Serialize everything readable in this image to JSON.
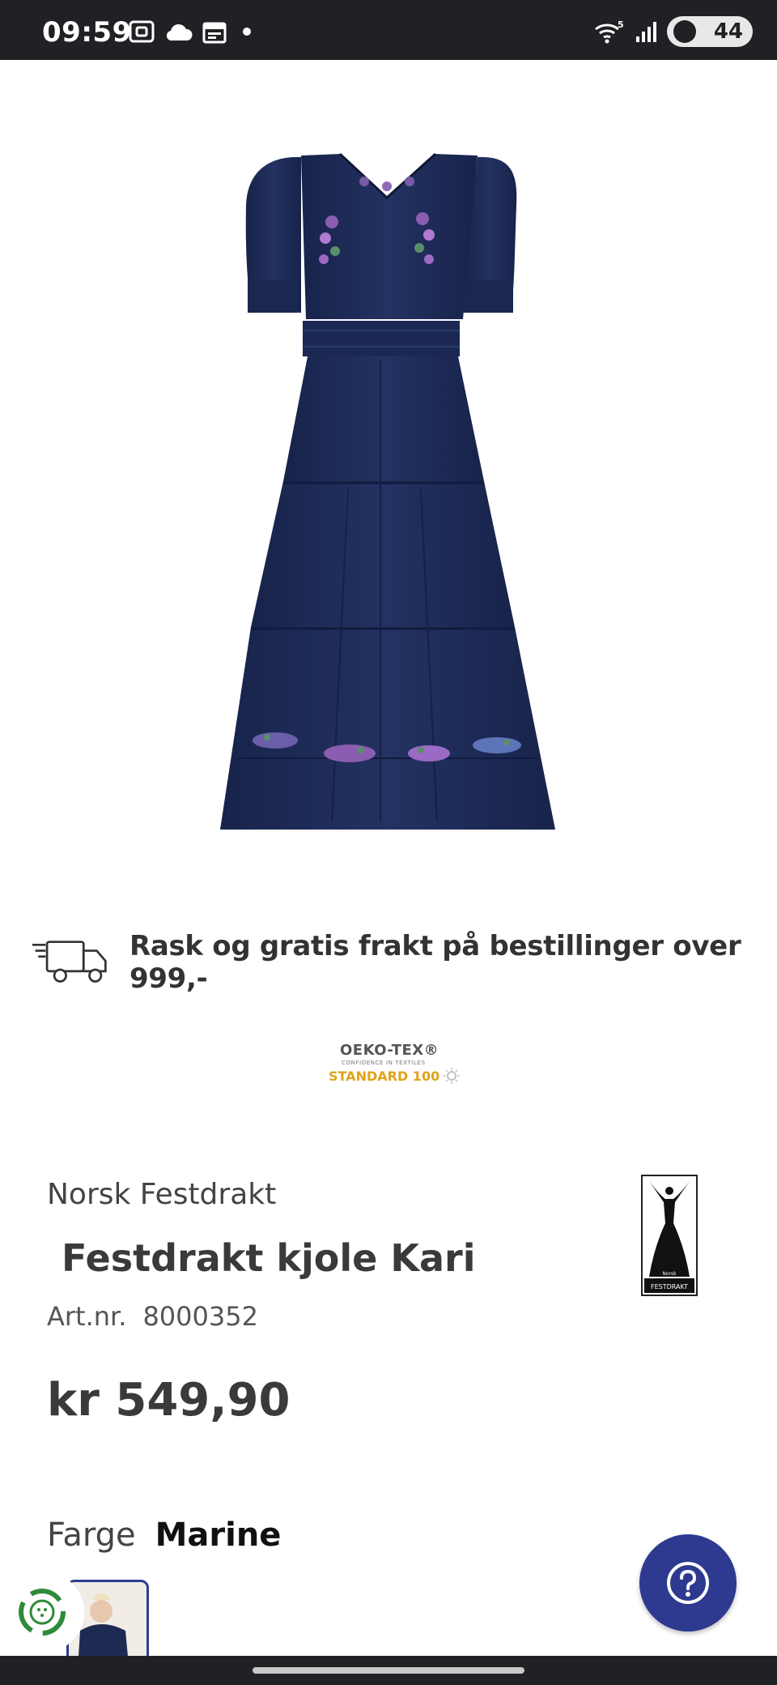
{
  "status_bar": {
    "time": "09:59",
    "battery": "44",
    "signal_icons": [
      "screenshot-icon",
      "cloud-icon",
      "calendar-icon",
      "dot-icon"
    ],
    "right_icons": [
      "wifi-icon",
      "signal-icon",
      "battery-icon"
    ],
    "wifi_label": "5"
  },
  "product": {
    "image_alt": "Navy blue tiered midi dress with embroidered flowers",
    "dress_color": "#1d2a52",
    "shipping_text": "Rask og gratis frakt på bestillinger over 999,-",
    "certification": {
      "line1": "OEKO-TEX®",
      "line2": "CONFIDENCE IN TEXTILES",
      "line3": "STANDARD 100"
    },
    "brand": "Norsk Festdrakt",
    "title": "Festdrakt kjole Kari",
    "art_label": "Art.nr.",
    "art_number": "8000352",
    "price": "kr 549,90",
    "color_label": "Farge",
    "color_value": "Marine",
    "brand_logo_text": "FESTDRAKT",
    "brand_logo_small": "Norsk"
  },
  "colors": {
    "accent": "#2d3a8f",
    "status_bar": "#202124",
    "recycle_green": "#2e8b3a",
    "oeko_gold": "#e0a21a"
  }
}
